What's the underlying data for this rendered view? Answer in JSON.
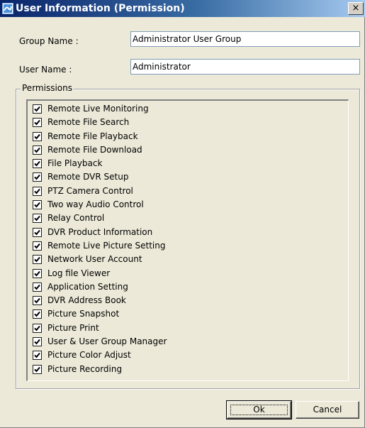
{
  "window": {
    "title": "User Information (Permission)",
    "close_glyph": "×",
    "app_icon": "app-icon"
  },
  "form": {
    "group_label": "Group Name :",
    "group_value": "Administrator User Group",
    "user_label": "User Name :",
    "user_value": "Administrator"
  },
  "permissions": {
    "title": "Permissions",
    "items": [
      {
        "label": "Remote Live Monitoring",
        "checked": true
      },
      {
        "label": "Remote File Search",
        "checked": true
      },
      {
        "label": "Remote File Playback",
        "checked": true
      },
      {
        "label": "Remote File Download",
        "checked": true
      },
      {
        "label": "File Playback",
        "checked": true
      },
      {
        "label": "Remote DVR Setup",
        "checked": true
      },
      {
        "label": "PTZ Camera Control",
        "checked": true
      },
      {
        "label": "Two way Audio Control",
        "checked": true
      },
      {
        "label": "Relay Control",
        "checked": true
      },
      {
        "label": "DVR Product Information",
        "checked": true
      },
      {
        "label": "Remote Live Picture Setting",
        "checked": true
      },
      {
        "label": "Network User Account",
        "checked": true
      },
      {
        "label": "Log file Viewer",
        "checked": true
      },
      {
        "label": "Application Setting",
        "checked": true
      },
      {
        "label": "DVR Address Book",
        "checked": true
      },
      {
        "label": "Picture Snapshot",
        "checked": true
      },
      {
        "label": "Picture Print",
        "checked": true
      },
      {
        "label": "User & User Group Manager",
        "checked": true
      },
      {
        "label": "Picture Color Adjust",
        "checked": true
      },
      {
        "label": "Picture Recording",
        "checked": true
      }
    ]
  },
  "buttons": {
    "ok": "Ok",
    "cancel": "Cancel"
  },
  "colors": {
    "title_start": "#0a246a",
    "title_end": "#a6caf0",
    "dialog_bg": "#ece9d8"
  }
}
